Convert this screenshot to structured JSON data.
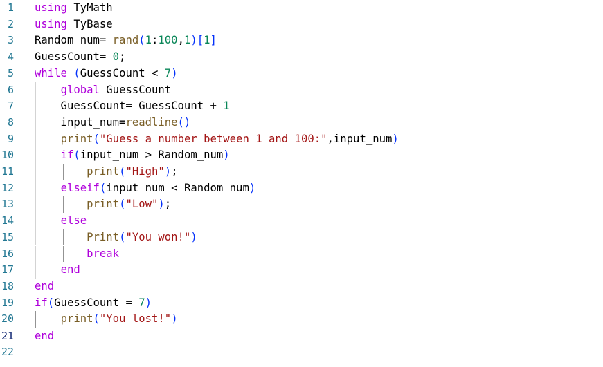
{
  "editor": {
    "line_numbers": [
      "1",
      "2",
      "3",
      "4",
      "5",
      "6",
      "7",
      "8",
      "9",
      "10",
      "11",
      "12",
      "13",
      "14",
      "15",
      "16",
      "17",
      "18",
      "19",
      "20",
      "21",
      "22"
    ],
    "lines": [
      [
        {
          "t": "using",
          "c": "kw"
        },
        {
          "t": " TyMath",
          "c": ""
        }
      ],
      [
        {
          "t": "using",
          "c": "kw"
        },
        {
          "t": " TyBase",
          "c": ""
        }
      ],
      [
        {
          "t": "Random_num= ",
          "c": ""
        },
        {
          "t": "rand",
          "c": "fn"
        },
        {
          "t": "(",
          "c": "br1"
        },
        {
          "t": "1",
          "c": "num"
        },
        {
          "t": ":",
          "c": ""
        },
        {
          "t": "100",
          "c": "num"
        },
        {
          "t": ",",
          "c": ""
        },
        {
          "t": "1",
          "c": "num"
        },
        {
          "t": ")",
          "c": "br1"
        },
        {
          "t": "[",
          "c": "br1"
        },
        {
          "t": "1",
          "c": "num"
        },
        {
          "t": "]",
          "c": "br1"
        }
      ],
      [
        {
          "t": "GuessCount= ",
          "c": ""
        },
        {
          "t": "0",
          "c": "num"
        },
        {
          "t": ";",
          "c": ""
        }
      ],
      [
        {
          "t": "while",
          "c": "kw"
        },
        {
          "t": " ",
          "c": ""
        },
        {
          "t": "(",
          "c": "br1"
        },
        {
          "t": "GuessCount < ",
          "c": ""
        },
        {
          "t": "7",
          "c": "num"
        },
        {
          "t": ")",
          "c": "br1"
        }
      ],
      [
        {
          "t": "    ",
          "c": ""
        },
        {
          "t": "global",
          "c": "kw"
        },
        {
          "t": " GuessCount",
          "c": ""
        }
      ],
      [
        {
          "t": "    GuessCount= GuessCount + ",
          "c": ""
        },
        {
          "t": "1",
          "c": "num"
        }
      ],
      [
        {
          "t": "    input_num=",
          "c": ""
        },
        {
          "t": "readline",
          "c": "fn"
        },
        {
          "t": "()",
          "c": "br1"
        }
      ],
      [
        {
          "t": "    ",
          "c": ""
        },
        {
          "t": "print",
          "c": "fn"
        },
        {
          "t": "(",
          "c": "br1"
        },
        {
          "t": "\"Guess a number between 1 and 100:\"",
          "c": "str"
        },
        {
          "t": ",input_num",
          "c": ""
        },
        {
          "t": ")",
          "c": "br1"
        }
      ],
      [
        {
          "t": "    ",
          "c": ""
        },
        {
          "t": "if",
          "c": "kw"
        },
        {
          "t": "(",
          "c": "br1"
        },
        {
          "t": "input_num > Random_num",
          "c": ""
        },
        {
          "t": ")",
          "c": "br1"
        }
      ],
      [
        {
          "t": "        ",
          "c": ""
        },
        {
          "t": "print",
          "c": "fn"
        },
        {
          "t": "(",
          "c": "br1"
        },
        {
          "t": "\"High\"",
          "c": "str"
        },
        {
          "t": ")",
          "c": "br1"
        },
        {
          "t": ";",
          "c": ""
        }
      ],
      [
        {
          "t": "    ",
          "c": ""
        },
        {
          "t": "elseif",
          "c": "kw"
        },
        {
          "t": "(",
          "c": "br1"
        },
        {
          "t": "input_num < Random_num",
          "c": ""
        },
        {
          "t": ")",
          "c": "br1"
        }
      ],
      [
        {
          "t": "        ",
          "c": ""
        },
        {
          "t": "print",
          "c": "fn"
        },
        {
          "t": "(",
          "c": "br1"
        },
        {
          "t": "\"Low\"",
          "c": "str"
        },
        {
          "t": ")",
          "c": "br1"
        },
        {
          "t": ";",
          "c": ""
        }
      ],
      [
        {
          "t": "    ",
          "c": ""
        },
        {
          "t": "else",
          "c": "kw"
        }
      ],
      [
        {
          "t": "        ",
          "c": ""
        },
        {
          "t": "Print",
          "c": "fn"
        },
        {
          "t": "(",
          "c": "br1"
        },
        {
          "t": "\"You won!\"",
          "c": "str"
        },
        {
          "t": ")",
          "c": "br1"
        }
      ],
      [
        {
          "t": "        ",
          "c": ""
        },
        {
          "t": "break",
          "c": "kw"
        }
      ],
      [
        {
          "t": "    ",
          "c": ""
        },
        {
          "t": "end",
          "c": "kw"
        }
      ],
      [
        {
          "t": "end",
          "c": "kw"
        }
      ],
      [
        {
          "t": "if",
          "c": "kw"
        },
        {
          "t": "(",
          "c": "br1"
        },
        {
          "t": "GuessCount = ",
          "c": ""
        },
        {
          "t": "7",
          "c": "num"
        },
        {
          "t": ")",
          "c": "br1"
        }
      ],
      [
        {
          "t": "    ",
          "c": ""
        },
        {
          "t": "print",
          "c": "fn"
        },
        {
          "t": "(",
          "c": "br1"
        },
        {
          "t": "\"You lost!\"",
          "c": "str"
        },
        {
          "t": ")",
          "c": "br1"
        }
      ],
      [
        {
          "t": "end",
          "c": "kw"
        }
      ],
      []
    ],
    "active_line": 21
  },
  "colors": {
    "line_number": "#237893",
    "keyword": "#af00db",
    "number": "#098658",
    "string": "#a31515",
    "function": "#795e26",
    "bracket": "#0431fa"
  }
}
